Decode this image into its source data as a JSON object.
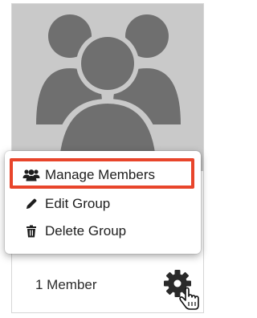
{
  "card": {
    "member_count": "1 Member",
    "avatar_icon": "group-avatar-icon",
    "settings_icon": "gear-icon"
  },
  "menu": {
    "items": [
      {
        "label": "Manage Members",
        "icon": "users-icon",
        "highlighted": true
      },
      {
        "label": "Edit Group",
        "icon": "pencil-icon"
      },
      {
        "label": "Delete Group",
        "icon": "trash-icon"
      }
    ]
  },
  "colors": {
    "highlight": "#e8452b",
    "avatar_bg": "#c9c9c9",
    "avatar_fg": "#6f6f6f"
  }
}
